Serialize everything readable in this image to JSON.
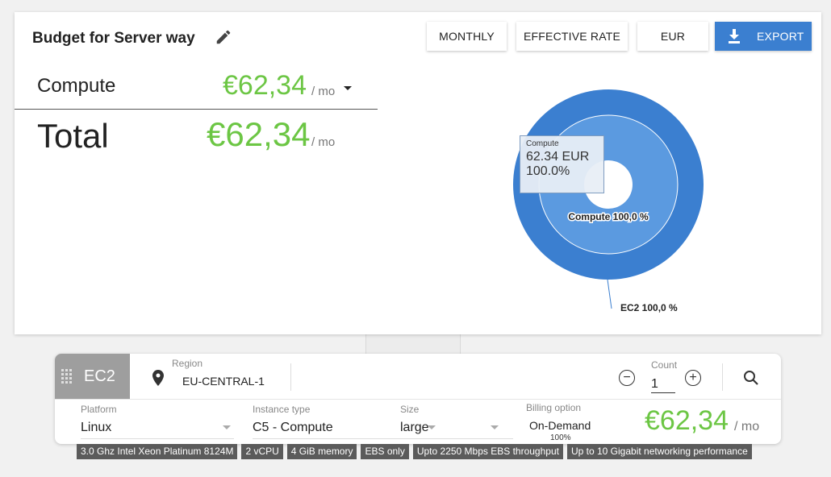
{
  "budget": {
    "title": "Budget for Server way",
    "buttons": {
      "monthly": "MONTHLY",
      "effective_rate": "EFFECTIVE RATE",
      "currency": "EUR",
      "export": "EXPORT"
    },
    "compute_label": "Compute",
    "compute_amount": "€62,34",
    "per_month": "/ mo",
    "total_label": "Total",
    "total_amount": "€62,34"
  },
  "chart_data": {
    "type": "pie",
    "title": "",
    "rings": [
      {
        "level": "outer",
        "categories": [
          "EC2"
        ],
        "values": [
          62.34
        ],
        "labels": [
          "EC2 100,0 %"
        ],
        "color": "#3b7fd0"
      },
      {
        "level": "inner",
        "categories": [
          "Compute"
        ],
        "values": [
          62.34
        ],
        "labels": [
          "Compute 100,0 %"
        ],
        "color": "#5b9ae0"
      }
    ],
    "tooltip": {
      "name": "Compute",
      "value": "62.34 EUR",
      "percent": "100.0%"
    }
  },
  "service": {
    "name": "EC2",
    "region_label": "Region",
    "region_value": "EU-CENTRAL-1",
    "count_label": "Count",
    "count_value": "1",
    "platform_label": "Platform",
    "platform_value": "Linux",
    "instance_type_label": "Instance type",
    "instance_type_value": "C5 - Compute",
    "size_label": "Size",
    "size_value": "large",
    "billing_label": "Billing option",
    "billing_value": "On-Demand",
    "billing_percent": "100%",
    "price": "€62,34",
    "per_month": "/ mo"
  },
  "specs": [
    "3.0 Ghz Intel Xeon Platinum 8124M",
    "2 vCPU",
    "4 GiB memory",
    "EBS only",
    "Upto 2250 Mbps EBS throughput",
    "Up to 10 Gigabit networking performance"
  ],
  "colors": {
    "accent_blue": "#3b7fd0",
    "price_green": "#6cc644",
    "tag_bg": "#5b5b5b"
  }
}
